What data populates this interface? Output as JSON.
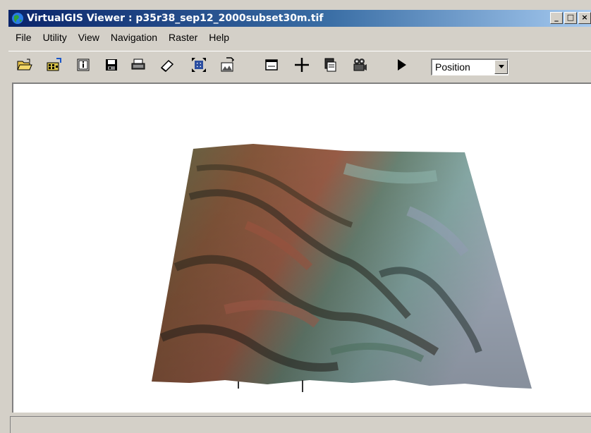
{
  "window": {
    "title": "VirtualGIS Viewer : p35r38_sep12_2000subset30m.tif",
    "controls": {
      "minimize": "_",
      "maximize": "□",
      "close": "×"
    }
  },
  "menu": [
    "File",
    "Utility",
    "View",
    "Navigation",
    "Raster",
    "Help"
  ],
  "toolbar": {
    "buttons": [
      {
        "icon": "open-folder-icon"
      },
      {
        "icon": "open-raster-icon"
      },
      {
        "icon": "info-icon"
      },
      {
        "icon": "save-icon"
      },
      {
        "icon": "print-icon"
      },
      {
        "icon": "eraser-icon"
      },
      {
        "icon": "fit-extent-icon"
      },
      {
        "icon": "export-image-icon"
      },
      {
        "icon": "window-icon"
      },
      {
        "icon": "crosshair-icon"
      },
      {
        "icon": "copy-icon"
      },
      {
        "icon": "movie-camera-icon"
      },
      {
        "icon": "play-icon"
      }
    ],
    "mode_select": {
      "value": "Position"
    }
  },
  "colors": {
    "titlebar_start": "#0a246a",
    "titlebar_end": "#a6caf0",
    "chrome": "#d4d0c8",
    "viewport_bg": "#ffffff"
  },
  "statusbar": {
    "text": ""
  }
}
